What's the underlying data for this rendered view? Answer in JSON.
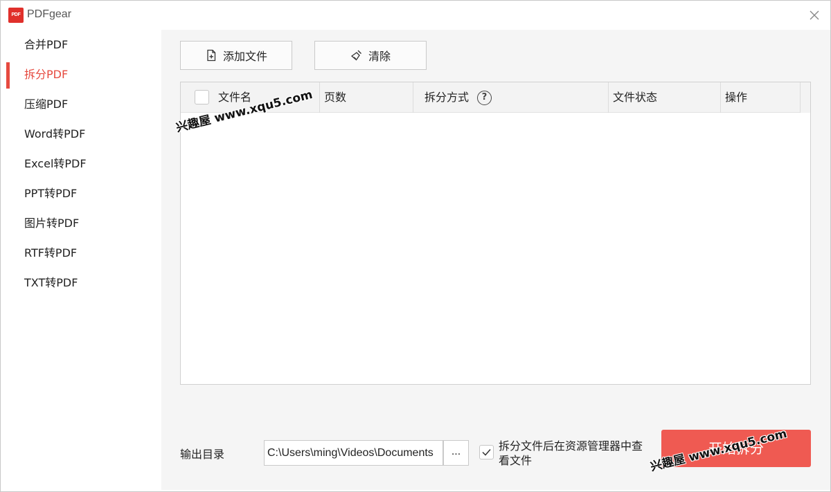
{
  "window": {
    "title": "PDFgear",
    "logo_text": "PDF",
    "close_icon": "close-icon"
  },
  "sidebar": {
    "items": [
      {
        "label": "合并PDF",
        "active": false
      },
      {
        "label": "拆分PDF",
        "active": true
      },
      {
        "label": "压缩PDF",
        "active": false
      },
      {
        "label": "Word转PDF",
        "active": false
      },
      {
        "label": "Excel转PDF",
        "active": false
      },
      {
        "label": "PPT转PDF",
        "active": false
      },
      {
        "label": "图片转PDF",
        "active": false
      },
      {
        "label": "RTF转PDF",
        "active": false
      },
      {
        "label": "TXT转PDF",
        "active": false
      }
    ]
  },
  "toolbar": {
    "add_label": "添加文件",
    "add_icon": "add-file-icon",
    "clear_label": "清除",
    "clear_icon": "broom-icon"
  },
  "table": {
    "columns": [
      "文件名",
      "页数",
      "拆分方式",
      "文件状态",
      "操作"
    ],
    "help_icon": "?",
    "rows": []
  },
  "output": {
    "label": "输出目录",
    "path": "C:\\Users\\ming\\Videos\\Documents",
    "browse_label": "...",
    "open_after_checked": true,
    "open_after_label": "拆分文件后在资源管理器中查看文件"
  },
  "start_button": "开始拆分",
  "watermark": "兴趣屋 www.xqu5.com",
  "colors": {
    "accent": "#e64a3f",
    "start_button": "#ef5a52",
    "main_bg": "#f5f5f5"
  }
}
